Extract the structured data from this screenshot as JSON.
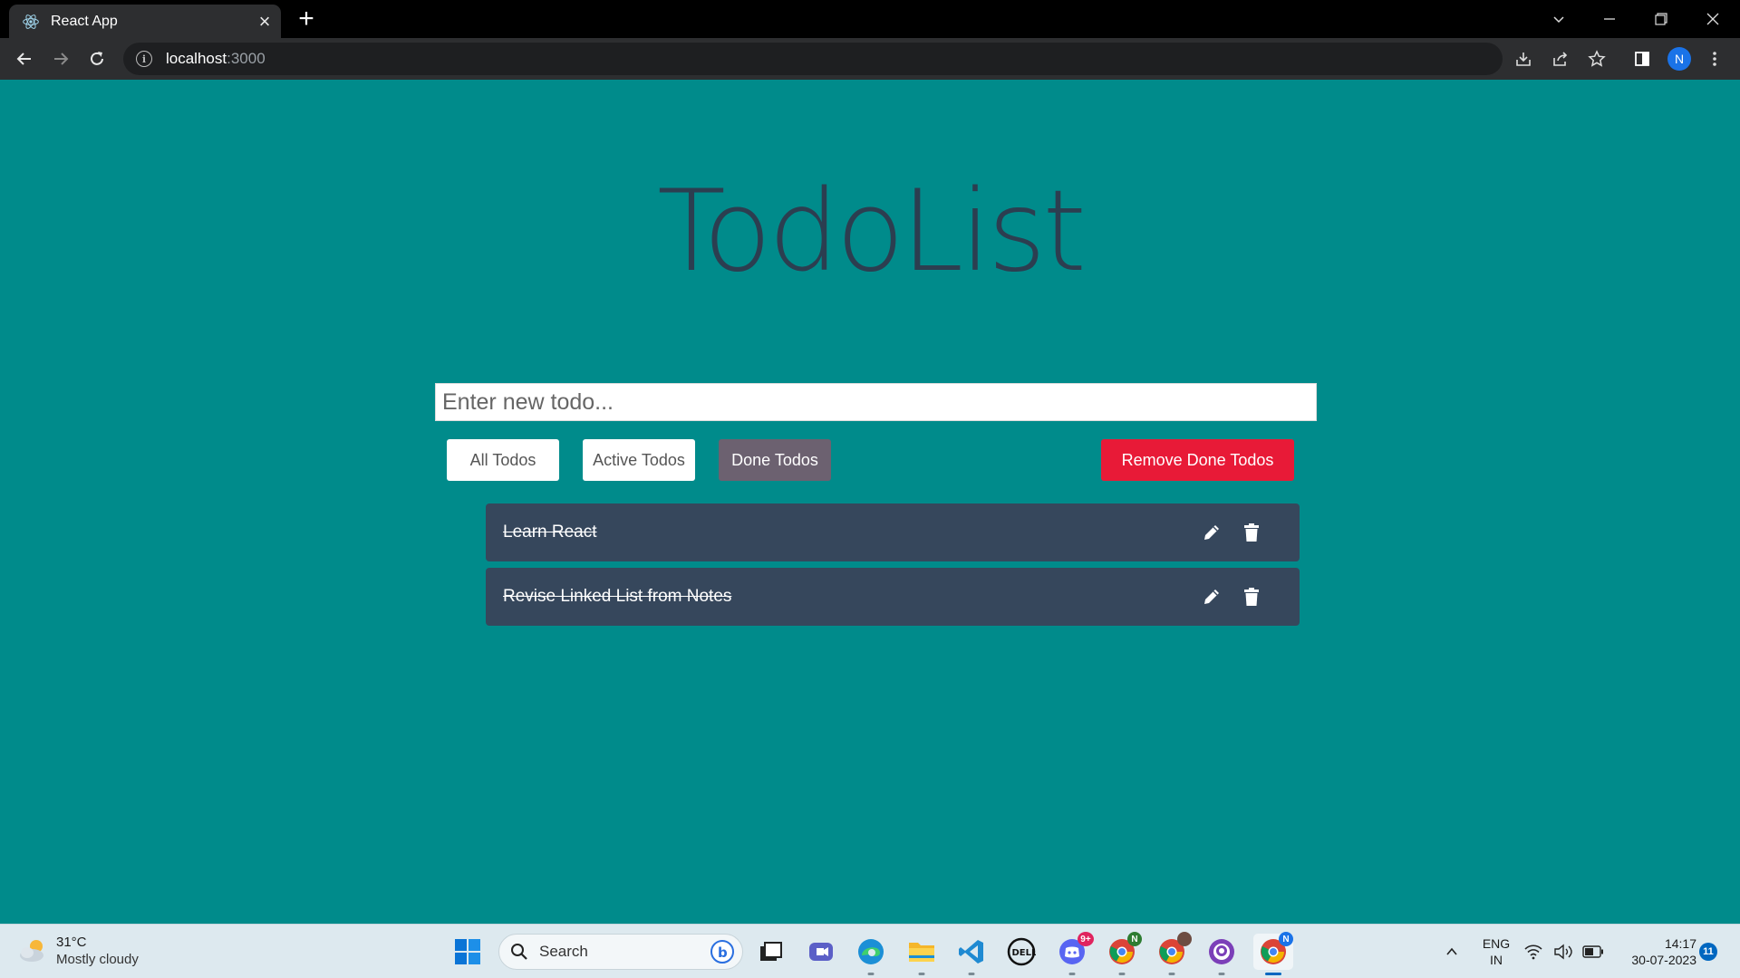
{
  "browser": {
    "tab_title": "React App",
    "url_host": "localhost",
    "url_port": ":3000",
    "profile_initial": "N"
  },
  "app": {
    "title": "TodoList",
    "input_placeholder": "Enter new todo...",
    "filters": {
      "all": "All Todos",
      "active": "Active Todos",
      "done": "Done Todos",
      "selected": "done"
    },
    "remove_done_label": "Remove Done Todos",
    "todos": [
      {
        "text": "Learn React",
        "done": true
      },
      {
        "text": "Revise Linked List from Notes",
        "done": true
      }
    ],
    "colors": {
      "background": "#008b8b",
      "title": "#2c3e50",
      "item_bg": "#36475c",
      "active_filter": "#6c6170",
      "danger": "#e81a37"
    }
  },
  "taskbar": {
    "weather_temp": "31°C",
    "weather_condition": "Mostly cloudy",
    "search_label": "Search",
    "language_line1": "ENG",
    "language_line2": "IN",
    "time": "14:17",
    "date": "30-07-2023",
    "notification_count": "11",
    "discord_badge": "9+",
    "chrome_profile_badges": [
      "N",
      "N"
    ]
  }
}
